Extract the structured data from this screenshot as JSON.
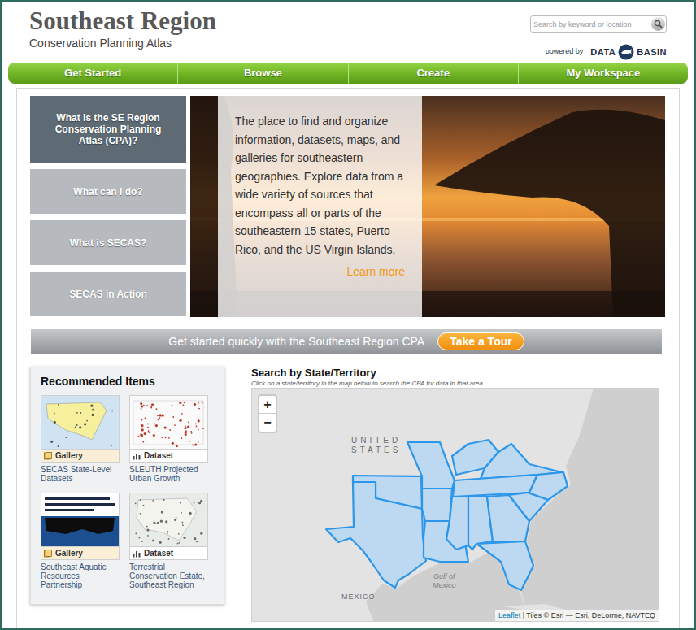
{
  "header": {
    "title": "Southeast Region",
    "subtitle": "Conservation Planning Atlas",
    "search": {
      "placeholder": "Search by keyword or location"
    },
    "powered_by": "powered by",
    "brand_left": "DATA",
    "brand_right": "BASIN"
  },
  "nav": [
    {
      "label": "Get Started"
    },
    {
      "label": "Browse"
    },
    {
      "label": "Create"
    },
    {
      "label": "My Workspace"
    }
  ],
  "intro_tabs": [
    {
      "label": "What is the SE Region Conservation Planning Atlas (CPA)?",
      "selected": true
    },
    {
      "label": "What can I do?",
      "selected": false
    },
    {
      "label": "What is SECAS?",
      "selected": false
    },
    {
      "label": "SECAS in Action",
      "selected": false
    }
  ],
  "hero": {
    "text": "The place to find and organize information, datasets, maps, and galleries for southeastern geographies. Explore data from a wide variety of sources that encompass all or parts of the southeastern 15 states, Puerto Rico, and the US Virgin Islands.",
    "link": "Learn more"
  },
  "tour": {
    "text": "Get started quickly with the Southeast Region CPA",
    "button": "Take a Tour"
  },
  "recommended": {
    "title": "Recommended Items",
    "items": [
      {
        "kind": "gallery",
        "type": "Gallery",
        "title": "SECAS State-Level Datasets"
      },
      {
        "kind": "dataset",
        "type": "Dataset",
        "title": "SLEUTH Projected Urban Growth"
      },
      {
        "kind": "gallery",
        "type": "Gallery",
        "title": "Southeast Aquatic Resources Partnership"
      },
      {
        "kind": "dataset",
        "type": "Dataset",
        "title": "Terrestrial Conservation Estate, Southeast Region"
      }
    ]
  },
  "map": {
    "title": "Search by State/Territory",
    "hint": "Click on a state/territory in the map below to search the CPA for data in that area.",
    "zoom_in": "+",
    "zoom_out": "−",
    "country_label": [
      "UNITED",
      "STATES"
    ],
    "mexico_label": "MÉXICO",
    "gulf_label": [
      "Gulf of",
      "Mexico"
    ],
    "attribution_link": "Leaflet",
    "attribution": "| Tiles © Esri — Esri, DeLorme, NAVTEQ"
  }
}
